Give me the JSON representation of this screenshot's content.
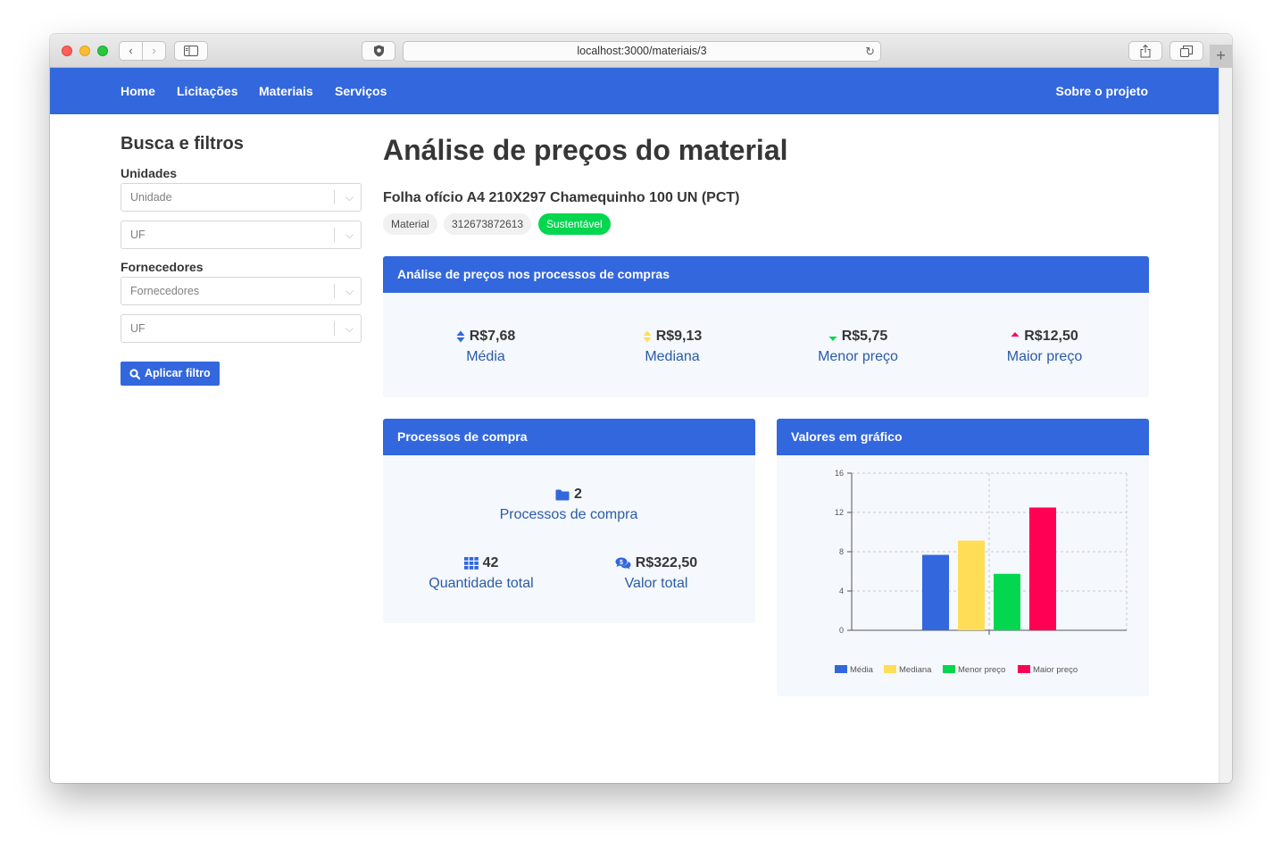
{
  "browser": {
    "url": "localhost:3000/materiais/3"
  },
  "navbar": {
    "links": [
      "Home",
      "Licitações",
      "Materiais",
      "Serviços"
    ],
    "about": "Sobre o projeto"
  },
  "filters": {
    "title": "Busca e filtros",
    "units_label": "Unidades",
    "unit_placeholder": "Unidade",
    "uf_placeholder": "UF",
    "suppliers_label": "Fornecedores",
    "supplier_placeholder": "Fornecedores",
    "uf2_placeholder": "UF",
    "apply_label": "Aplicar filtro"
  },
  "page": {
    "title": "Análise de preços do material",
    "material_name": "Folha ofício A4 210X297 Chamequinho 100 UN (PCT)",
    "tags": [
      "Material",
      "312673872613",
      "Sustentável"
    ]
  },
  "price_analysis": {
    "header": "Análise de preços nos processos de compras",
    "stats": [
      {
        "value": "R$7,68",
        "label": "Média",
        "icon": "sort-icon",
        "color": "#3367dd"
      },
      {
        "value": "R$9,13",
        "label": "Mediana",
        "icon": "sort-icon",
        "color": "#ffdd57"
      },
      {
        "value": "R$5,75",
        "label": "Menor preço",
        "icon": "caret-down-icon",
        "color": "#02d74f"
      },
      {
        "value": "R$12,50",
        "label": "Maior preço",
        "icon": "caret-up-icon",
        "color": "#ff0054"
      }
    ]
  },
  "processes": {
    "header": "Processos de compra",
    "count_value": "2",
    "count_label": "Processos de compra",
    "quantity_value": "42",
    "quantity_label": "Quantidade total",
    "total_value": "R$322,50",
    "total_label": "Valor total"
  },
  "chart_card": {
    "header": "Valores em gráfico"
  },
  "chart_data": {
    "type": "bar",
    "series": [
      {
        "name": "Média",
        "value": 7.68,
        "color": "#3367dd"
      },
      {
        "name": "Mediana",
        "value": 9.13,
        "color": "#ffdd57"
      },
      {
        "name": "Menor preço",
        "value": 5.75,
        "color": "#02d74f"
      },
      {
        "name": "Maior preço",
        "value": 12.5,
        "color": "#ff0054"
      }
    ],
    "yticks": [
      "0",
      "4",
      "8",
      "12",
      "16"
    ],
    "ylim": [
      0,
      16
    ],
    "grid": true,
    "legend": "bottom"
  }
}
